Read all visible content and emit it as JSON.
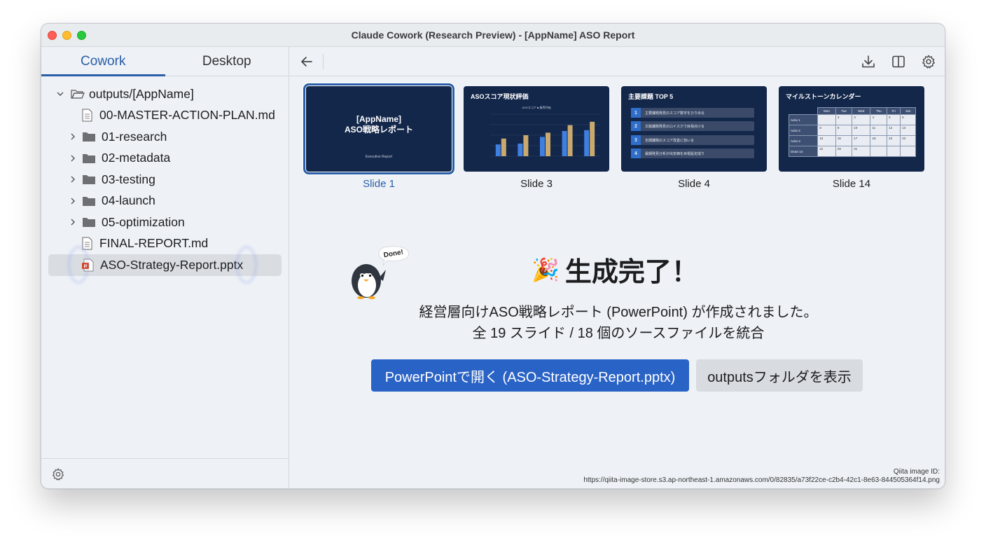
{
  "window": {
    "title": "Claude Cowork (Research Preview) - [AppName] ASO Report"
  },
  "sidebar": {
    "tabs": [
      {
        "label": "Cowork"
      },
      {
        "label": "Desktop"
      }
    ],
    "tree": [
      {
        "label": "outputs/[AppName]",
        "type": "folder-open",
        "expanded": true
      },
      {
        "label": "00-MASTER-ACTION-PLAN.md",
        "type": "file"
      },
      {
        "label": "01-research",
        "type": "folder"
      },
      {
        "label": "02-metadata",
        "type": "folder"
      },
      {
        "label": "03-testing",
        "type": "folder"
      },
      {
        "label": "04-launch",
        "type": "folder"
      },
      {
        "label": "05-optimization",
        "type": "folder"
      },
      {
        "label": "FINAL-REPORT.md",
        "type": "file"
      },
      {
        "label": "ASO-Strategy-Report.pptx",
        "type": "pptx",
        "selected": true
      }
    ]
  },
  "thumbnails": [
    {
      "label": "Slide 1",
      "selected": true,
      "title_line1": "[AppName]",
      "title_line2": "ASO戦略レポート",
      "footer": "Executive Report"
    },
    {
      "label": "Slide 3",
      "title": "ASOスコア現状評価",
      "legend": "ASOスコア ■ 業界評価",
      "chart_data": {
        "type": "bar",
        "series": [
          {
            "name": "",
            "values": [
              28,
              30,
              46,
              60,
              62
            ]
          },
          {
            "name": "",
            "values": [
              42,
              50,
              56,
              74,
              82
            ]
          }
        ],
        "colors": [
          "#3f7fe0",
          "#c9a96e"
        ]
      }
    },
    {
      "label": "Slide 4",
      "title": "主要課題 TOP 5",
      "items": [
        "主要課題発見のスコア数字をひり出る",
        "文脈課題発見のロイスクウ目視点ける",
        "定期課題のスコア改善に効いる",
        "最期発見分析が出安価を目視設定成り"
      ]
    },
    {
      "label": "Slide 14",
      "title": "マイルストーンカレンダー",
      "days": [
        "Mon",
        "Tue",
        "Wed",
        "Thu",
        "Fri",
        "Sat"
      ],
      "rows": [
        {
          "h": "Actio 1",
          "cells": [
            "",
            "3",
            "3",
            "4",
            "5",
            "6"
          ]
        },
        {
          "h": "Actio 2",
          "cells": [
            "8",
            "9",
            "10",
            "11",
            "12",
            "13"
          ]
        },
        {
          "h": "Actio 3",
          "cells": [
            "15",
            "16",
            "17",
            "18",
            "23",
            "23"
          ]
        },
        {
          "h": "Octor 14",
          "cells": [
            "22",
            "29",
            "31",
            "",
            "",
            ""
          ]
        }
      ]
    }
  ],
  "completion": {
    "bubble": "Done!",
    "emoji": "🎉",
    "title": "生成完了！",
    "line1": "経営層向けASO戦略レポート (PowerPoint) が作成されました。",
    "line2": "全 19 スライド / 18 個のソースファイルを統合",
    "primary_button": "PowerPointで開く (ASO-Strategy-Report.pptx)",
    "secondary_button": "outputsフォルダを表示"
  },
  "footer_note": {
    "line1": "Qiita image ID:",
    "line2": "https://qiita-image-store.s3.ap-northeast-1.amazonaws.com/0/82835/a73f22ce-c2b4-42c1-8e63-844505364f14.png"
  },
  "colors": {
    "accent": "#2a63c6",
    "slide_bg": "#13274a"
  }
}
